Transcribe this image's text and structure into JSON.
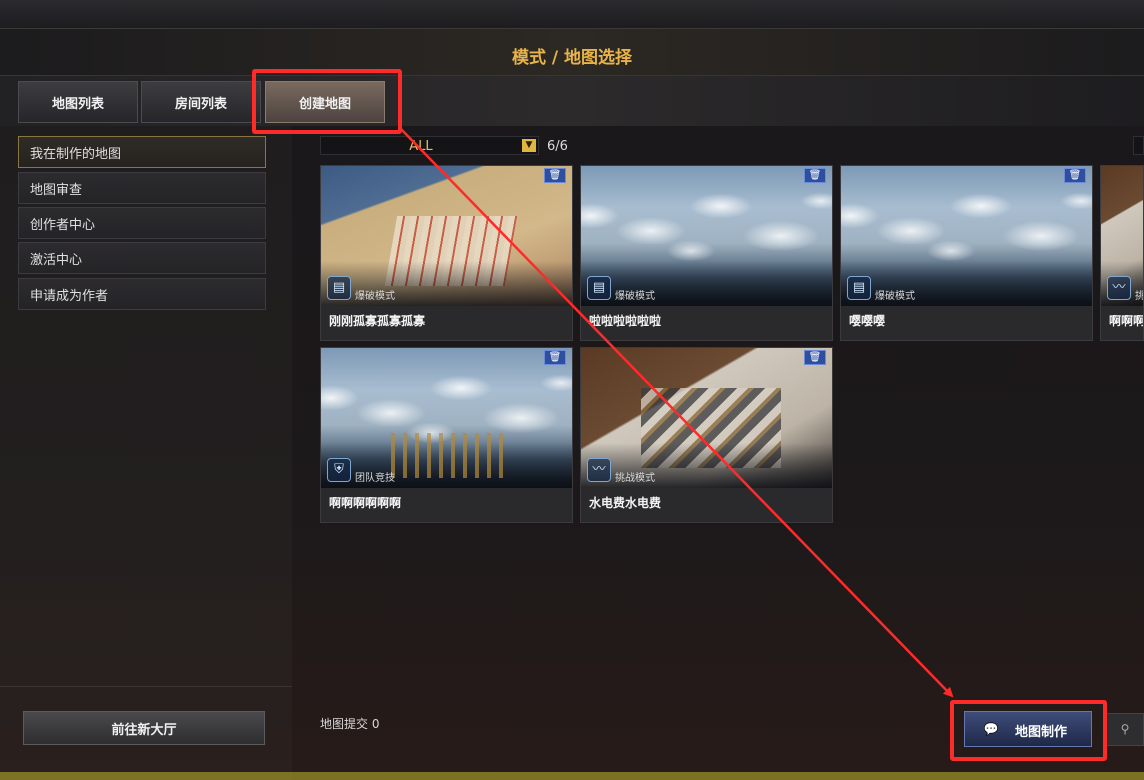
{
  "title": "模式 / 地图选择",
  "tabs": [
    {
      "label": "地图列表"
    },
    {
      "label": "房间列表"
    },
    {
      "label": "创建地图"
    }
  ],
  "sidebar": {
    "items": [
      {
        "label": "我在制作的地图"
      },
      {
        "label": "地图审查"
      },
      {
        "label": "创作者中心"
      },
      {
        "label": "激活中心"
      },
      {
        "label": "申请成为作者"
      }
    ],
    "lobby_button": "前往新大厅"
  },
  "filter": {
    "value": "ALL",
    "count": "6/6"
  },
  "maps": [
    {
      "name": "刚刚孤寡孤寡孤寡",
      "mode": "爆破模式",
      "icon": "demolition-icon"
    },
    {
      "name": "啦啦啦啦啦啦",
      "mode": "爆破模式",
      "icon": "demolition-icon"
    },
    {
      "name": "嘤嘤嘤",
      "mode": "爆破模式",
      "icon": "demolition-icon"
    },
    {
      "name": "啊啊啊",
      "mode": "挑",
      "icon": "challenge-icon"
    },
    {
      "name": "啊啊啊啊啊啊",
      "mode": "团队竞技",
      "icon": "team-battle-icon"
    },
    {
      "name": "水电费水电费",
      "mode": "挑战模式",
      "icon": "challenge-icon"
    }
  ],
  "footer": {
    "submit_text": "地图提交 0",
    "make_button": "地图制作"
  },
  "colors": {
    "accent": "#e7b34a",
    "highlight": "#ff2a2a",
    "primary_button": "#2e3b66"
  }
}
